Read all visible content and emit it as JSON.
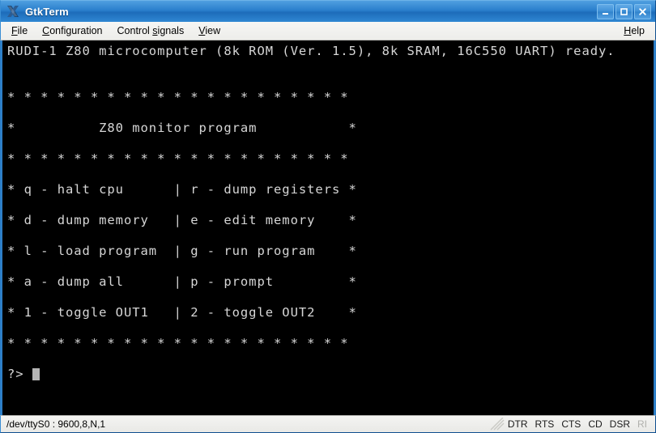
{
  "window": {
    "title": "GtkTerm",
    "icon": "x11-logo-icon",
    "controls": {
      "minimize": "−",
      "maximize": "□",
      "close": "✕"
    }
  },
  "menubar": {
    "items": [
      {
        "label": "File",
        "mnemonic": "F"
      },
      {
        "label": "Configuration",
        "mnemonic": "C"
      },
      {
        "label": "Control signals",
        "mnemonic": "s"
      },
      {
        "label": "View",
        "mnemonic": "V"
      }
    ],
    "help": {
      "label": "Help",
      "mnemonic": "H"
    }
  },
  "terminal": {
    "lines": [
      "RUDI-1 Z80 microcomputer (8k ROM (Ver. 1.5), 8k SRAM, 16C550 UART) ready.",
      "",
      "",
      "* * * * * * * * * * * * * * * * * * * * *",
      "",
      "*          Z80 monitor program           *",
      "",
      "* * * * * * * * * * * * * * * * * * * * *",
      "",
      "* q - halt cpu      | r - dump registers *",
      "",
      "* d - dump memory   | e - edit memory    *",
      "",
      "* l - load program  | g - run program    *",
      "",
      "* a - dump all      | p - prompt         *",
      "",
      "* 1 - toggle OUT1   | 2 - toggle OUT2    *",
      "",
      "* * * * * * * * * * * * * * * * * * * * *",
      ""
    ],
    "prompt": "?> ",
    "cursor_visible": true
  },
  "statusbar": {
    "port": "/dev/ttyS0 : 9600,8,N,1",
    "grip": "resize-grip-icon",
    "signals": [
      {
        "label": "DTR",
        "active": true
      },
      {
        "label": "RTS",
        "active": true
      },
      {
        "label": "CTS",
        "active": true
      },
      {
        "label": "CD",
        "active": true
      },
      {
        "label": "DSR",
        "active": true
      },
      {
        "label": "RI",
        "active": false
      }
    ]
  },
  "colors": {
    "titlebar_blue": "#2a7fcc",
    "window_border": "#2d7fc8",
    "terminal_bg": "#000000",
    "terminal_fg": "#d6d6d6",
    "cursor": "#b4b4b4",
    "signal_off": "#b0b0ac"
  }
}
